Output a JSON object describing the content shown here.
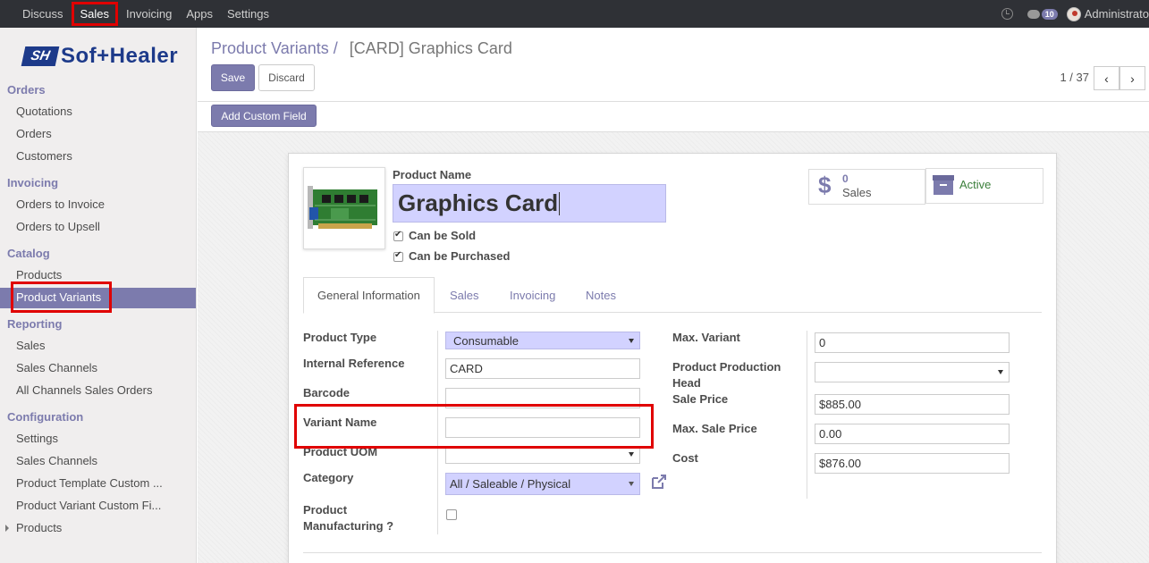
{
  "topbar": {
    "menu": [
      "Discuss",
      "Sales",
      "Invoicing",
      "Apps",
      "Settings"
    ],
    "active_menu": "Sales",
    "message_count": "10",
    "user": "Administrato"
  },
  "sidebar": {
    "brand": {
      "mark": "SH",
      "text": "Sof+Healer"
    },
    "sections": {
      "orders": "Orders",
      "invoicing": "Invoicing",
      "catalog": "Catalog",
      "reporting": "Reporting",
      "configuration": "Configuration"
    },
    "items": {
      "quotations": "Quotations",
      "orders": "Orders",
      "customers": "Customers",
      "orders_to_invoice": "Orders to Invoice",
      "orders_to_upsell": "Orders to Upsell",
      "products": "Products",
      "product_variants": "Product Variants",
      "sales": "Sales",
      "sales_channels": "Sales Channels",
      "all_channels_sales_orders": "All Channels Sales Orders",
      "settings": "Settings",
      "config_sales_channels": "Sales Channels",
      "product_template_custom": "Product Template Custom ...",
      "product_variant_custom": "Product Variant Custom Fi...",
      "config_products": "Products"
    },
    "active_item": "Product Variants"
  },
  "control_panel": {
    "breadcrumb_parent": "Product Variants",
    "breadcrumb_sep": "/",
    "breadcrumb_current": "[CARD] Graphics Card",
    "save_label": "Save",
    "discard_label": "Discard",
    "pager": "1 / 37",
    "add_custom_field_label": "Add Custom Field"
  },
  "form": {
    "product_name_label": "Product Name",
    "product_name": "Graphics Card",
    "can_be_sold_label": "Can be Sold",
    "can_be_sold": true,
    "can_be_purchased_label": "Can be Purchased",
    "can_be_purchased": true,
    "stat_sales_count": "0",
    "stat_sales_label": "Sales",
    "stat_active_label": "Active",
    "tabs": [
      "General Information",
      "Sales",
      "Invoicing",
      "Notes"
    ],
    "active_tab": "General Information",
    "left_fields": {
      "product_type_label": "Product Type",
      "product_type": "Consumable",
      "internal_reference_label": "Internal Reference",
      "internal_reference": "CARD",
      "barcode_label": "Barcode",
      "barcode": "",
      "variant_name_label": "Variant Name",
      "variant_name": "",
      "product_uom_label": "Product UOM",
      "product_uom": "",
      "category_label": "Category",
      "category": "All / Saleable / Physical",
      "product_manufacturing_label_1": "Product",
      "product_manufacturing_label_2": "Manufacturing ?",
      "product_manufacturing": false
    },
    "right_fields": {
      "max_variant_label": "Max. Variant",
      "max_variant": "0",
      "production_head_label_1": "Product Production",
      "production_head_label_2": "Head",
      "production_head": "",
      "sale_price_label": "Sale Price",
      "sale_price": "$885.00",
      "max_sale_price_label": "Max. Sale Price",
      "max_sale_price": "0.00",
      "cost_label": "Cost",
      "cost": "$876.00"
    }
  },
  "colors": {
    "accent": "#7c7bad",
    "topbar": "#2f3136",
    "highlight_box": "#e00000",
    "input_highlight": "#d2d2ff"
  }
}
